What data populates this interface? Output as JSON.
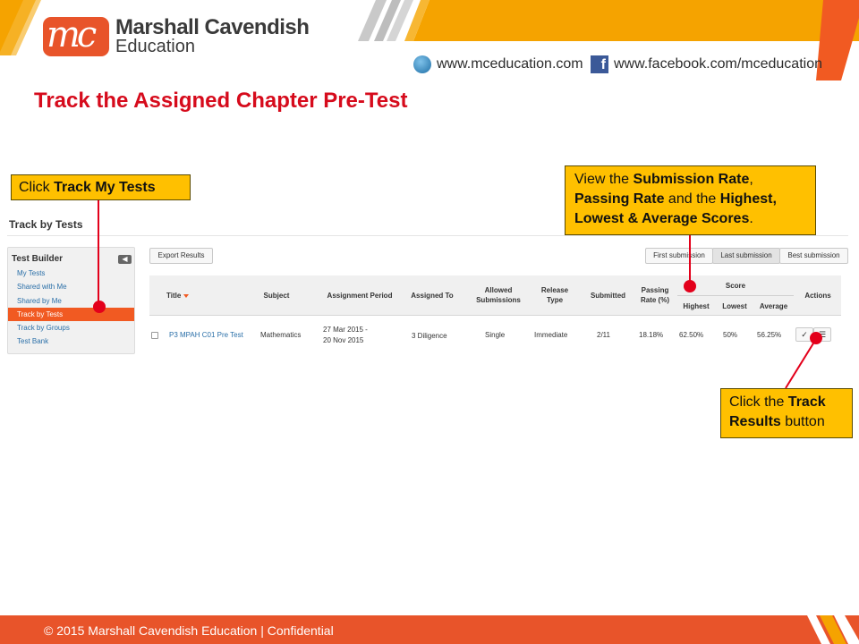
{
  "colors": {
    "brand_orange": "#f5a300",
    "accent_orange": "#f15a22",
    "title_red": "#d60b1c",
    "callout_yellow": "#ffc000",
    "annotation_red": "#e3001b",
    "footer_orange": "#e8542a"
  },
  "header": {
    "logo_mark": "mc",
    "brand_line1": "Marshall Cavendish",
    "brand_line2": "Education",
    "website": "www.mceducation.com",
    "facebook": "www.facebook.com/mceducation",
    "website_icon": "globe-icon",
    "facebook_icon": "facebook-icon"
  },
  "slide_title": "Track the Assigned Chapter Pre-Test",
  "callouts": {
    "track_my_tests": {
      "prefix": "Click ",
      "bold": "Track My Tests"
    },
    "view_rates": {
      "l1_a": "View the ",
      "l1_b": "Submission Rate",
      "l1_c": ",",
      "l2_a": "Passing Rate",
      "l2_b": " and the ",
      "l2_c": "Highest,",
      "l3_a": "Lowest & Average Scores",
      "l3_b": "."
    },
    "track_results": {
      "l1_a": "Click the ",
      "l1_b": "Track",
      "l2_a": "Results",
      "l2_b": " button"
    }
  },
  "app": {
    "page_heading": "Track by Tests",
    "sidebar": {
      "title": "Test Builder",
      "collapse_icon": "chevron-left-icon",
      "items": [
        {
          "label": "My Tests",
          "active": false
        },
        {
          "label": "Shared with Me",
          "active": false
        },
        {
          "label": "Shared by Me",
          "active": false
        },
        {
          "label": "Track by Tests",
          "active": true
        },
        {
          "label": "Track by Groups",
          "active": false
        },
        {
          "label": "Test Bank",
          "active": false
        }
      ]
    },
    "toolbar": {
      "export": "Export Results",
      "first_submission": "First submission",
      "last_submission": "Last submission",
      "best_submission": "Best submission",
      "selected": "Last submission"
    },
    "table": {
      "headers": {
        "title": "Title",
        "subject": "Subject",
        "assignment_period": "Assignment Period",
        "assigned_to": "Assigned To",
        "allowed_submissions": "Allowed Submissions",
        "release_type": "Release Type",
        "submitted": "Submitted",
        "passing_rate": "Passing Rate (%)",
        "score": "Score",
        "highest": "Highest",
        "lowest": "Lowest",
        "average": "Average",
        "actions": "Actions"
      },
      "rows": [
        {
          "title": "P3 MPAH C01 Pre Test",
          "subject": "Mathematics",
          "period_start": "27 Mar 2015 -",
          "period_end": "20 Nov 2015",
          "assigned_to": "3 Diligence",
          "allowed_submissions": "Single",
          "release_type": "Immediate",
          "submitted": "2/11",
          "passing_rate": "18.18%",
          "highest": "62.50%",
          "lowest": "50%",
          "average": "56.25%",
          "action_icons": [
            "check-icon",
            "list-icon"
          ]
        }
      ]
    }
  },
  "footer": {
    "text": "© 2015 Marshall Cavendish Education | Confidential"
  }
}
